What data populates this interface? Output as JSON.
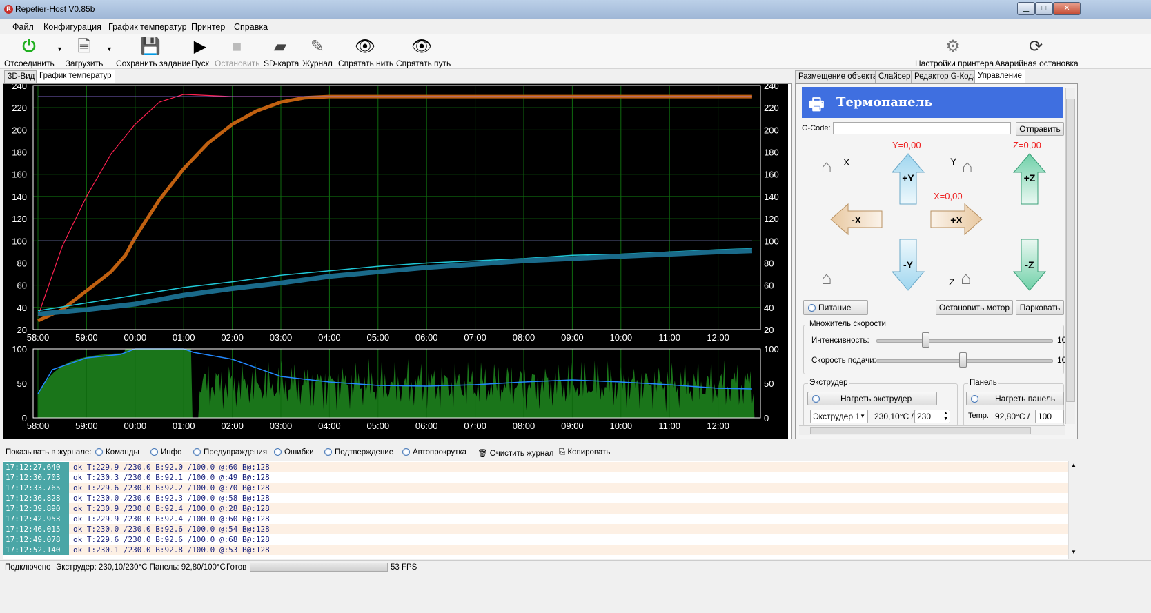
{
  "window": {
    "title": "Repetier-Host V0.85b",
    "min": "▁",
    "max": "□",
    "close": "✕"
  },
  "menu": [
    "Файл",
    "Конфигурация",
    "График температур",
    "Принтер",
    "Справка"
  ],
  "toolbar": {
    "disconnect": "Отсоединить",
    "load": "Загрузить",
    "save_job": "Сохранить задание",
    "run": "Пуск",
    "stop": "Остановить",
    "sd": "SD-карта",
    "log": "Журнал",
    "hide_filament": "Спрятать нить",
    "hide_path": "Спрятать путь",
    "printer_settings": "Настройки принтера",
    "emergency": "Аварийная остановка"
  },
  "left_tabs": [
    "3D-Вид",
    "График температур"
  ],
  "right_tabs": [
    "Размещение объекта",
    "Слайсер",
    "Редактор G-Кода",
    "Управление"
  ],
  "control": {
    "header": "Термопанель",
    "gcode_label": "G-Code:",
    "gcode_value": "",
    "send": "Отправить",
    "y_pos": "Y=0,00",
    "z_pos": "Z=0,00",
    "x_pos": "X=0,00",
    "lbl_x": "X",
    "lbl_y": "Y",
    "lbl_z": "Z",
    "plus_y": "+Y",
    "minus_y": "-Y",
    "plus_x": "+X",
    "minus_x": "-X",
    "plus_z": "+Z",
    "minus_z": "-Z",
    "power": "Питание",
    "stop_motor": "Остановить мотор",
    "park": "Парковать",
    "speed_group": "Множитель скорости",
    "intensity": "Интенсивность:",
    "feed": "Скорость подачи:",
    "intensity_val": "10",
    "feed_val": "10",
    "extruder_group": "Экструдер",
    "heat_extruder": "Нагреть экструдер",
    "extruder_select": "Экструдер 1",
    "extruder_temp": "230,10°C /",
    "extruder_target": "230",
    "bed_group": "Панель",
    "heat_bed": "Нагреть панель",
    "bed_label": "Temp.",
    "bed_temp": "92,80°C /",
    "bed_target": "100"
  },
  "chart_data": [
    {
      "type": "line",
      "title": "",
      "ylim": [
        20,
        240
      ],
      "x": [
        "58:00",
        "59:00",
        "00:00",
        "01:00",
        "02:00",
        "03:00",
        "04:00",
        "05:00",
        "06:00",
        "07:00",
        "08:00",
        "09:00",
        "10:00",
        "11:00",
        "12:00"
      ],
      "yticks": [
        20,
        40,
        60,
        80,
        100,
        120,
        140,
        160,
        180,
        200,
        220,
        240
      ],
      "series": [
        {
          "color": "#ff2050",
          "points": [
            [
              0,
              32
            ],
            [
              0.5,
              95
            ],
            [
              1,
              140
            ],
            [
              1.5,
              178
            ],
            [
              2,
              205
            ],
            [
              2.5,
              225
            ],
            [
              3,
              232
            ],
            [
              3.5,
              231
            ],
            [
              4,
              230
            ],
            [
              5,
              230
            ],
            [
              6,
              230
            ],
            [
              7,
              230
            ],
            [
              8,
              230
            ],
            [
              9,
              230
            ],
            [
              10,
              230
            ],
            [
              11,
              230
            ],
            [
              12,
              230
            ],
            [
              13,
              230
            ],
            [
              14,
              230
            ],
            [
              14.7,
              230
            ]
          ]
        },
        {
          "color": "#c06010",
          "points": [
            [
              0,
              28
            ],
            [
              0.5,
              38
            ],
            [
              1,
              55
            ],
            [
              1.5,
              72
            ],
            [
              1.8,
              87
            ],
            [
              2,
              103
            ],
            [
              2.5,
              137
            ],
            [
              3,
              165
            ],
            [
              3.5,
              188
            ],
            [
              4,
              205
            ],
            [
              4.5,
              217
            ],
            [
              5,
              225
            ],
            [
              5.5,
              229
            ],
            [
              6,
              230
            ],
            [
              7,
              230
            ],
            [
              8,
              230
            ],
            [
              9,
              230
            ],
            [
              10,
              230
            ],
            [
              11,
              230
            ],
            [
              12,
              230
            ],
            [
              13,
              230
            ],
            [
              14,
              230
            ],
            [
              14.7,
              230
            ]
          ]
        },
        {
          "color": "#20c8d8",
          "points": [
            [
              0,
              37
            ],
            [
              1,
              44
            ],
            [
              2,
              51
            ],
            [
              3,
              58
            ],
            [
              4,
              63
            ],
            [
              5,
              69
            ],
            [
              6,
              73
            ],
            [
              7,
              77
            ],
            [
              8,
              80
            ],
            [
              9,
              82
            ],
            [
              10,
              84
            ],
            [
              11,
              87
            ],
            [
              12,
              88
            ],
            [
              13,
              90
            ],
            [
              14,
              92
            ],
            [
              14.7,
              93
            ]
          ]
        },
        {
          "color": "#1a6a8a",
          "points": [
            [
              0,
              34
            ],
            [
              1,
              38
            ],
            [
              2,
              43
            ],
            [
              3,
              51
            ],
            [
              4,
              57
            ],
            [
              5,
              62
            ],
            [
              6,
              68
            ],
            [
              7,
              72
            ],
            [
              8,
              76
            ],
            [
              9,
              79
            ],
            [
              10,
              82
            ],
            [
              11,
              84
            ],
            [
              12,
              86
            ],
            [
              13,
              88
            ],
            [
              14,
              90
            ],
            [
              14.7,
              91
            ]
          ]
        },
        {
          "color": "#a080ff",
          "points": [
            [
              0,
              230
            ],
            [
              14.7,
              230
            ]
          ]
        },
        {
          "color": "#a080ff",
          "points": [
            [
              0,
              100
            ],
            [
              14.7,
              100
            ]
          ]
        }
      ]
    },
    {
      "type": "area",
      "title": "",
      "ylim": [
        0,
        100
      ],
      "x": [
        "58:00",
        "59:00",
        "00:00",
        "01:00",
        "02:00",
        "03:00",
        "04:00",
        "05:00",
        "06:00",
        "07:00",
        "08:00",
        "09:00",
        "10:00",
        "11:00",
        "12:00"
      ],
      "yticks": [
        0,
        50,
        100
      ],
      "series": [
        {
          "color": "#1f8a1f",
          "pattern": "full-then-noisy"
        },
        {
          "color": "#2288ff",
          "points": [
            [
              0,
              35
            ],
            [
              0.3,
              70
            ],
            [
              1,
              87
            ],
            [
              1.7,
              92
            ],
            [
              2,
              100
            ],
            [
              3,
              100
            ],
            [
              3.2,
              95
            ],
            [
              4,
              85
            ],
            [
              5,
              60
            ],
            [
              6,
              52
            ],
            [
              7,
              47
            ],
            [
              8,
              46
            ],
            [
              9,
              48
            ],
            [
              10,
              52
            ],
            [
              11,
              55
            ],
            [
              12,
              52
            ],
            [
              13,
              48
            ],
            [
              14,
              43
            ],
            [
              14.7,
              42
            ]
          ]
        }
      ]
    }
  ],
  "log": {
    "filters": [
      "Показывать в журнале:",
      "Команды",
      "Инфо",
      "Предупраждения",
      "Ошибки",
      "Подтверждение",
      "Автопрокрутка",
      "Очистить журнал",
      "Копировать"
    ],
    "rows": [
      {
        "t": "17:12:27.640",
        "m": "ok T:229.9 /230.0 B:92.0 /100.0 @:60 B@:128"
      },
      {
        "t": "17:12:30.703",
        "m": "ok T:230.3 /230.0 B:92.1 /100.0 @:49 B@:128"
      },
      {
        "t": "17:12:33.765",
        "m": "ok T:229.6 /230.0 B:92.2 /100.0 @:70 B@:128"
      },
      {
        "t": "17:12:36.828",
        "m": "ok T:230.0 /230.0 B:92.3 /100.0 @:58 B@:128"
      },
      {
        "t": "17:12:39.890",
        "m": "ok T:230.9 /230.0 B:92.4 /100.0 @:28 B@:128"
      },
      {
        "t": "17:12:42.953",
        "m": "ok T:229.9 /230.0 B:92.4 /100.0 @:60 B@:128"
      },
      {
        "t": "17:12:46.015",
        "m": "ok T:230.0 /230.0 B:92.6 /100.0 @:54 B@:128"
      },
      {
        "t": "17:12:49.078",
        "m": "ok T:229.6 /230.0 B:92.6 /100.0 @:68 B@:128"
      },
      {
        "t": "17:12:52.140",
        "m": "ok T:230.1 /230.0 B:92.8 /100.0 @:53 B@:128"
      }
    ]
  },
  "status": {
    "connected": "Подключено",
    "extruder": "Экструдер: 230,10/230°C Панель: 92,80/100°C",
    "ready": "Готов",
    "fps": "53 FPS"
  }
}
